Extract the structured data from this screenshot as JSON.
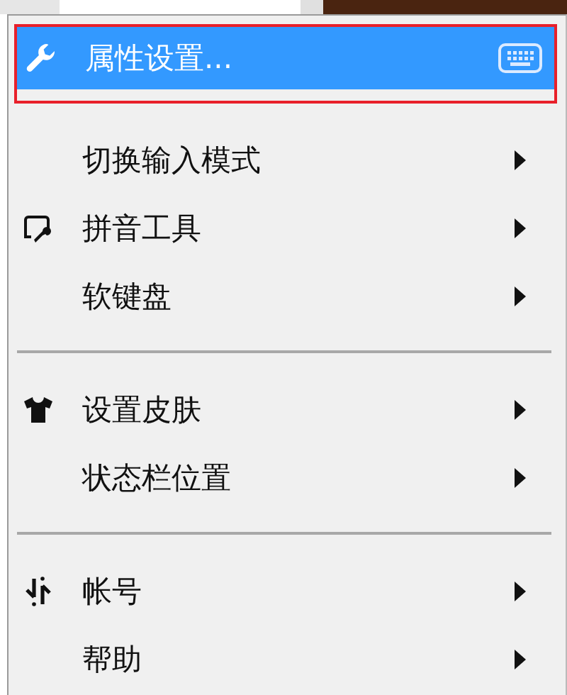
{
  "menu": {
    "items": [
      {
        "kind": "item",
        "label": "属性设置...",
        "selected": true,
        "has_submenu": false
      },
      {
        "kind": "item",
        "label": "切换输入模式",
        "selected": false,
        "has_submenu": true
      },
      {
        "kind": "item",
        "label": "拼音工具",
        "selected": false,
        "has_submenu": true
      },
      {
        "kind": "item",
        "label": "软键盘",
        "selected": false,
        "has_submenu": true
      },
      {
        "kind": "separator"
      },
      {
        "kind": "item",
        "label": "设置皮肤",
        "selected": false,
        "has_submenu": true
      },
      {
        "kind": "item",
        "label": "状态栏位置",
        "selected": false,
        "has_submenu": true
      },
      {
        "kind": "separator"
      },
      {
        "kind": "item",
        "label": "帐号",
        "selected": false,
        "has_submenu": true
      },
      {
        "kind": "item",
        "label": "帮助",
        "selected": false,
        "has_submenu": true
      }
    ]
  }
}
